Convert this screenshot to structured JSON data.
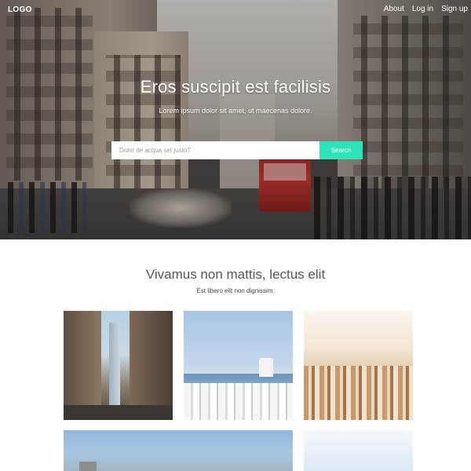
{
  "header": {
    "logo": "LOGO",
    "nav": [
      {
        "label": "About"
      },
      {
        "label": "Log in"
      },
      {
        "label": "Sign up"
      }
    ]
  },
  "hero": {
    "title": "Eros suscipit est facilisis",
    "subtitle": "Lorem ipsum dolor sit amet, ut maecenas dolore.",
    "search": {
      "placeholder": "Dolor de acqua set justo?",
      "value": "",
      "button_label": "Search"
    }
  },
  "section": {
    "title": "Vivamus non mattis, lectus elit",
    "subtitle": "Est libero elit non dignissim."
  },
  "gallery": [
    {
      "icon": "photo-city-street"
    },
    {
      "icon": "photo-santorini"
    },
    {
      "icon": "photo-city-sunset"
    },
    {
      "icon": "photo-coastline"
    },
    {
      "icon": "photo-sky"
    }
  ],
  "colors": {
    "accent": "#2ee3b8",
    "heading": "#555555",
    "background": "#ffffff"
  }
}
